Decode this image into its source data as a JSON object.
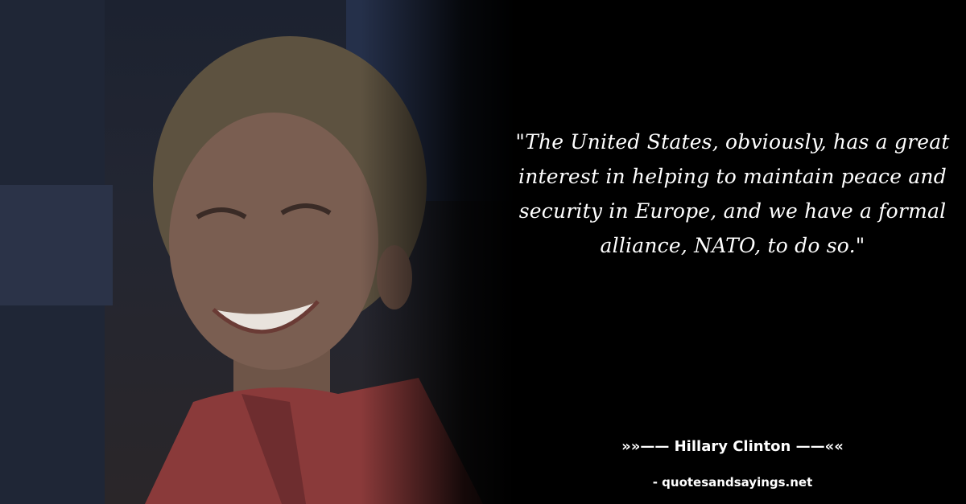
{
  "quote": {
    "text": "\"The United States, obviously, has a great interest in helping to maintain peace and security in Europe, and we have a formal alliance, NATO, to do so.\""
  },
  "author": {
    "line": "»»—— Hillary Clinton ——««"
  },
  "site": {
    "credit": "- quotesandsayings.net"
  },
  "colors": {
    "background": "#000000",
    "text": "#ffffff"
  }
}
